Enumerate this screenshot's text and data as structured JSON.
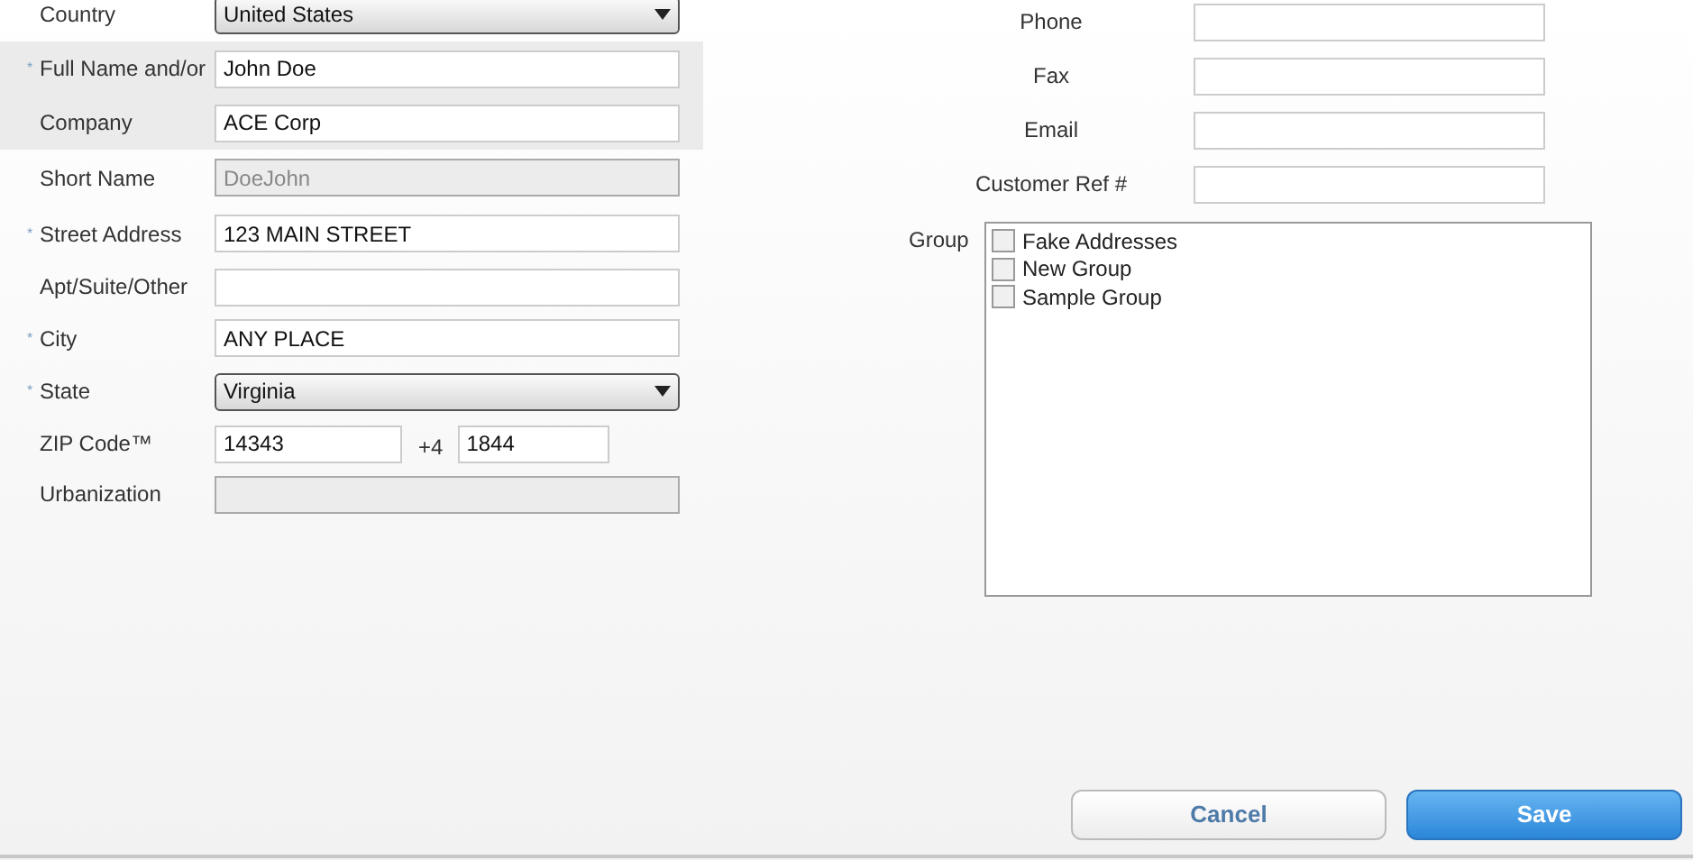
{
  "address_fields": [
    {
      "kind": "select",
      "label": "Country",
      "required": false,
      "highlighted": false,
      "value": "United States"
    },
    {
      "kind": "text",
      "label": "Full Name and/or",
      "required": true,
      "highlighted": true,
      "value": "John Doe"
    },
    {
      "kind": "text",
      "label": "Company",
      "required": false,
      "highlighted": true,
      "value": "ACE Corp"
    },
    {
      "kind": "disabled",
      "label": "Short Name",
      "required": false,
      "highlighted": false,
      "value": "DoeJohn"
    },
    {
      "kind": "text",
      "label": "Street Address",
      "required": true,
      "highlighted": false,
      "value": "123 MAIN STREET"
    },
    {
      "kind": "text",
      "label": "Apt/Suite/Other",
      "required": false,
      "highlighted": false
    },
    {
      "kind": "text",
      "label": "City",
      "required": true,
      "highlighted": false,
      "value": "ANY PLACE"
    },
    {
      "kind": "select",
      "label": "State",
      "required": true,
      "highlighted": false,
      "value": "Virginia"
    },
    {
      "kind": "zip",
      "label": "ZIP Code™",
      "required": false,
      "highlighted": false,
      "value": "14343",
      "plus_label": "+4",
      "plus_value": "1844"
    },
    {
      "kind": "disabled",
      "label": "Urbanization",
      "required": false,
      "highlighted": false
    }
  ],
  "required_mark": "*",
  "contact_fields": [
    {
      "label": "Phone"
    },
    {
      "label": "Fax"
    },
    {
      "label": "Email"
    },
    {
      "label": "Customer Ref #"
    }
  ],
  "group": {
    "label": "Group",
    "options": [
      {
        "label": "Fake Addresses",
        "checked": false
      },
      {
        "label": "New Group",
        "checked": false
      },
      {
        "label": "Sample Group",
        "checked": false
      }
    ]
  },
  "buttons": {
    "cancel": "Cancel",
    "save": "Save"
  }
}
